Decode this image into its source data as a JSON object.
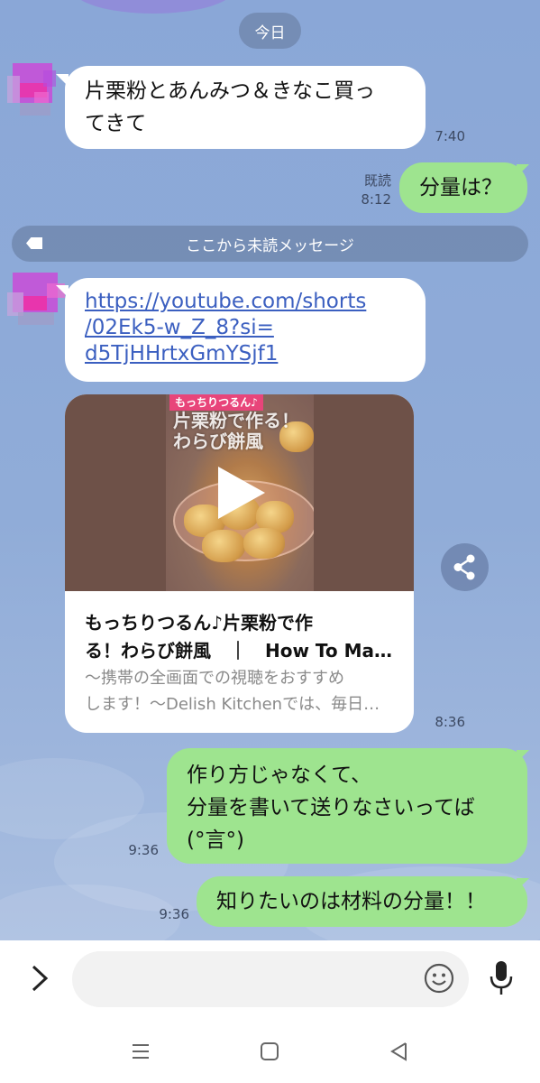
{
  "date_label": "今日",
  "messages": {
    "m1": {
      "text": "片栗粉とあんみつ＆きなこ買ってきて",
      "line1": "片栗粉とあんみつ＆きなこ買っ",
      "line2": "てきて",
      "time": "7:40"
    },
    "m2": {
      "text": "分量は？",
      "read": "既読",
      "time": "8:12"
    },
    "unread_divider": "ここから未読メッセージ",
    "m3": {
      "link_line1": "https://youtube.com/shorts",
      "link_line2": "/02Ek5-w_Z_8?si=",
      "link_line3": "d5TjHHrtxGmYSjf1"
    },
    "card": {
      "thumb_tag": "もっちりつるん♪",
      "thumb_title": "片栗粉で作る！わらび餅風",
      "title_line1": "もっちりつるん♪片栗粉で作",
      "title_line2a": "る！わらび餅風　｜　",
      "title_line2b": "How To Ma…",
      "desc_line1": "〜携帯の全画面での視聴をおすすめ",
      "desc_line2": "します！〜Delish Kitchenでは、毎日…",
      "time": "8:36"
    },
    "m4": {
      "line1": "作り方じゃなくて、",
      "line2": "分量を書いて送りなさいってば",
      "line3": "(°言°)",
      "time": "9:36"
    },
    "m5": {
      "text": "知りたいのは材料の分量！！",
      "time": "9:36"
    }
  },
  "input": {
    "placeholder": ""
  },
  "icons": {
    "expand": "chevron-right-icon",
    "emoji": "smiley-icon",
    "mic": "microphone-icon",
    "share": "share-icon",
    "play": "play-icon",
    "tag": "tag-icon",
    "nav": [
      "menu-icon",
      "home-icon",
      "back-icon"
    ]
  },
  "colors": {
    "chat_background": "#8da9d6",
    "outgoing_bubble": "#9ee48f",
    "incoming_bubble": "#ffffff",
    "link": "#3b5fc0"
  }
}
